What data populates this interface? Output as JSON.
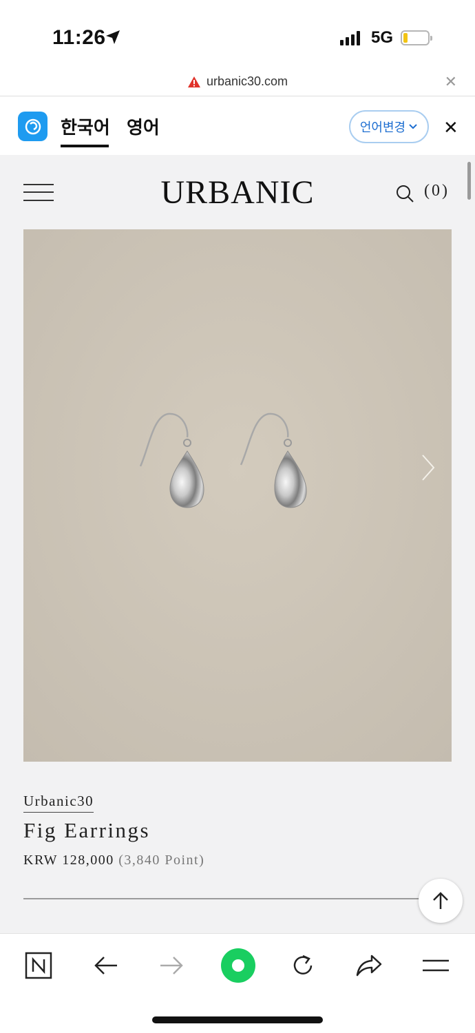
{
  "status_bar": {
    "time": "11:26",
    "network": "5G",
    "battery_color": "#f2c414"
  },
  "url_bar": {
    "url": "urbanic30.com",
    "warning_color": "#e0332b"
  },
  "translate_bar": {
    "tabs": [
      "한국어",
      "영어"
    ],
    "change_language_label": "언어변경",
    "accent_color": "#1e9bf0"
  },
  "site_header": {
    "logo": "URBANIC",
    "cart_count": "(0)"
  },
  "product": {
    "brand": "Urbanic30",
    "name": "Fig Earrings",
    "price": "KRW 128,000",
    "points": "(3,840 Point)"
  },
  "toolbar": {
    "icons": [
      "naver-n-icon",
      "back-arrow-icon",
      "forward-arrow-icon",
      "green-dot-home-icon",
      "refresh-icon",
      "share-icon",
      "menu-icon"
    ],
    "home_color": "#19ce60"
  }
}
